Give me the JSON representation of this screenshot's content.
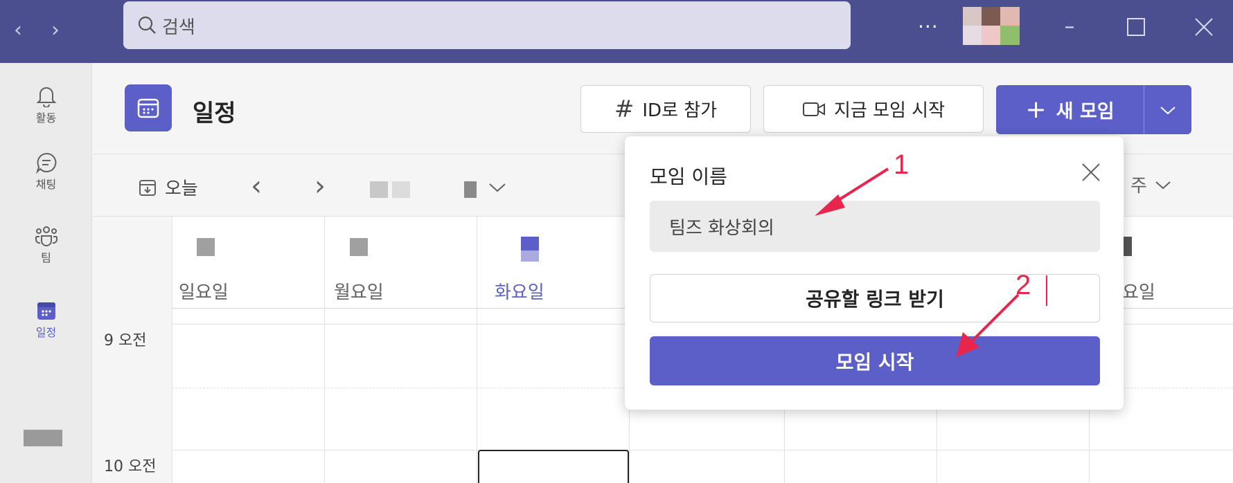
{
  "search": {
    "placeholder": "검색"
  },
  "titlebar": {
    "more": "···"
  },
  "rail": {
    "activity": "활동",
    "chat": "채팅",
    "teams": "팀",
    "calendar": "일정"
  },
  "header": {
    "title": "일정",
    "join_by_id": "ID로 참가",
    "meet_now": "지금 모임 시작",
    "new_meeting": "새 모임"
  },
  "toolbar": {
    "today": "오늘",
    "view": "주"
  },
  "days": [
    "일요일",
    "월요일",
    "화요일",
    "요일"
  ],
  "times": [
    "9 오전",
    "10 오전"
  ],
  "popup": {
    "title": "모임 이름",
    "meeting_name_value": "팀즈 화상회의",
    "get_link": "공유할 링크 받기",
    "start": "모임 시작"
  },
  "annotations": {
    "step1": "1",
    "step2": "2"
  },
  "colors": {
    "titlebar": "#4b4f8f",
    "accent": "#5b5fc7",
    "annotation": "#e8264d"
  }
}
